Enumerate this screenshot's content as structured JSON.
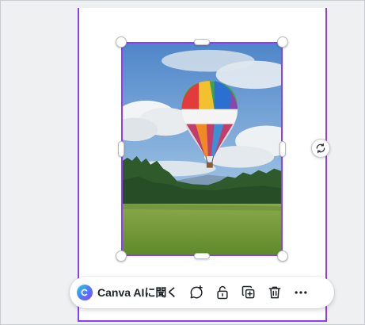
{
  "toolbar": {
    "ai_button_label": "Canva AIに聞く",
    "actions": [
      {
        "name": "comment-icon"
      },
      {
        "name": "lock-icon"
      },
      {
        "name": "duplicate-icon"
      },
      {
        "name": "trash-icon"
      },
      {
        "name": "more-options-icon"
      }
    ]
  },
  "canvas": {
    "selected_element": "hot-air-balloon-photo",
    "selection_color": "#8b3dff"
  },
  "colors": {
    "accent": "#8b3dff",
    "background": "#eef0f2",
    "page": "#ffffff"
  }
}
